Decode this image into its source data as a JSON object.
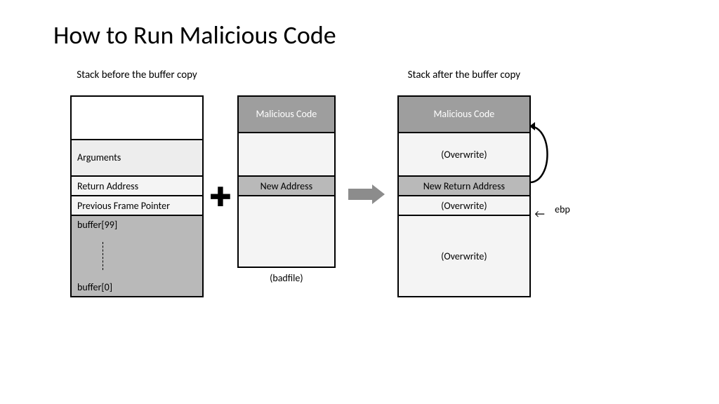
{
  "title": "How to Run Malicious Code",
  "columns": {
    "before": {
      "title": "Stack before the buffer copy",
      "cells": {
        "arguments": "Arguments",
        "return_addr": "Return Address",
        "frame_ptr": "Previous Frame Pointer",
        "buffer_top": "buffer[99]",
        "buffer_bottom": "buffer[0]"
      }
    },
    "badfile": {
      "cells": {
        "malicious": "Malicious Code",
        "new_addr": "New Address"
      },
      "below": "(badfile)"
    },
    "after": {
      "title": "Stack after the buffer copy",
      "cells": {
        "malicious": "Malicious Code",
        "overwrite1": "(Overwrite)",
        "new_return": "New Return Address",
        "overwrite2": "(Overwrite)",
        "overwrite3": "(Overwrite)"
      },
      "ebp": "ebp"
    }
  },
  "symbols": {
    "plus": "✚",
    "left_arrow": "←"
  }
}
